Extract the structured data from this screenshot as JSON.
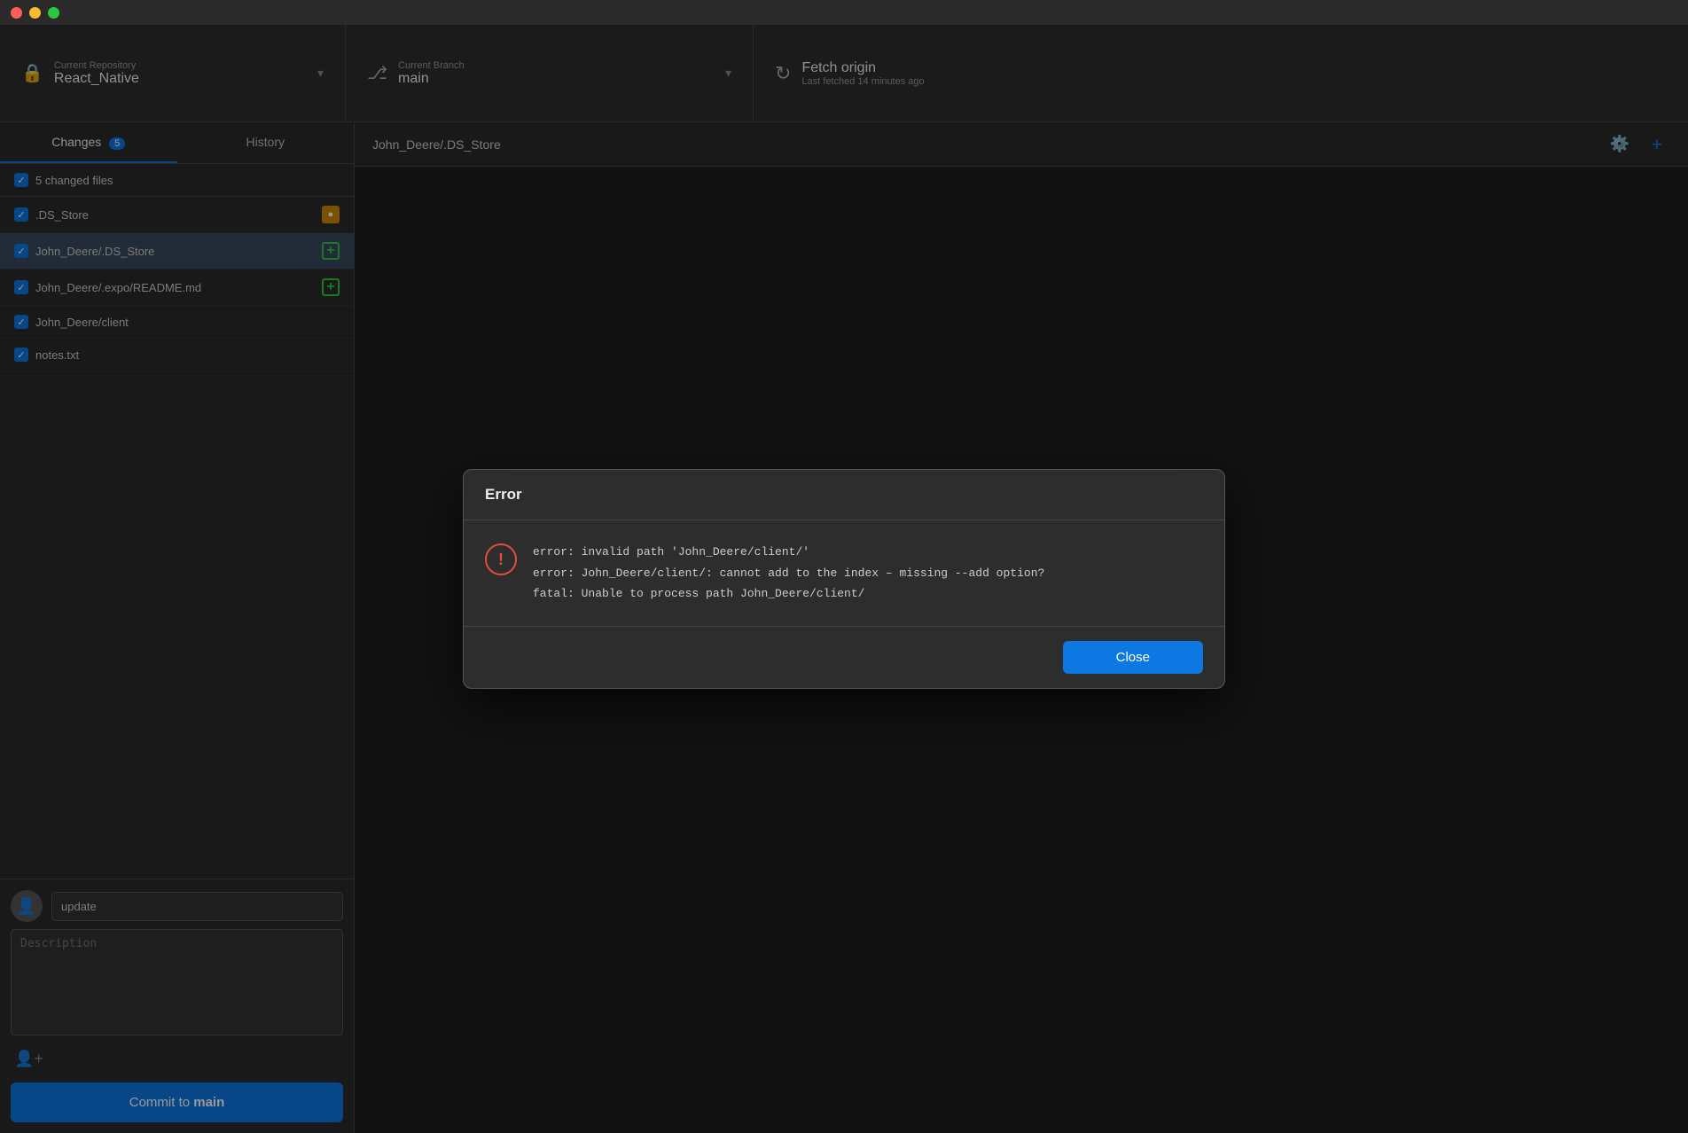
{
  "titlebar": {
    "traffic_lights": [
      "red",
      "yellow",
      "green"
    ]
  },
  "toolbar": {
    "repo_label": "Current Repository",
    "repo_name": "React_Native",
    "branch_label": "Current Branch",
    "branch_name": "main",
    "fetch_label": "Fetch origin",
    "fetch_sublabel": "Last fetched 14 minutes ago"
  },
  "sidebar": {
    "tab_changes": "Changes",
    "tab_changes_count": "5",
    "tab_history": "History",
    "changed_files_label": "5 changed files",
    "files": [
      {
        "name": ".DS_Store",
        "badge_type": "modified",
        "badge_label": "●",
        "selected": false
      },
      {
        "name": "John_Deere/.DS_Store",
        "badge_type": "added",
        "badge_label": "+",
        "selected": true
      },
      {
        "name": "John_Deere/.expo/README.md",
        "badge_type": "added",
        "badge_label": "+",
        "selected": false
      },
      {
        "name": "John_Deere/client",
        "badge_type": "none",
        "badge_label": "",
        "selected": false
      },
      {
        "name": "notes.txt",
        "badge_type": "none",
        "badge_label": "",
        "selected": false
      }
    ],
    "commit_input_value": "update",
    "commit_description_placeholder": "Description",
    "commit_button_label": "Commit to ",
    "commit_button_branch": "main",
    "add_coauthor_label": ""
  },
  "content": {
    "file_path": "John_Deere/.DS_Store"
  },
  "error_dialog": {
    "title": "Error",
    "line1": "error: invalid path 'John_Deere/client/'",
    "line2": "error: John_Deere/client/: cannot add to the index – missing --add option?",
    "line3": "fatal: Unable to process path John_Deere/client/",
    "close_button_label": "Close"
  }
}
